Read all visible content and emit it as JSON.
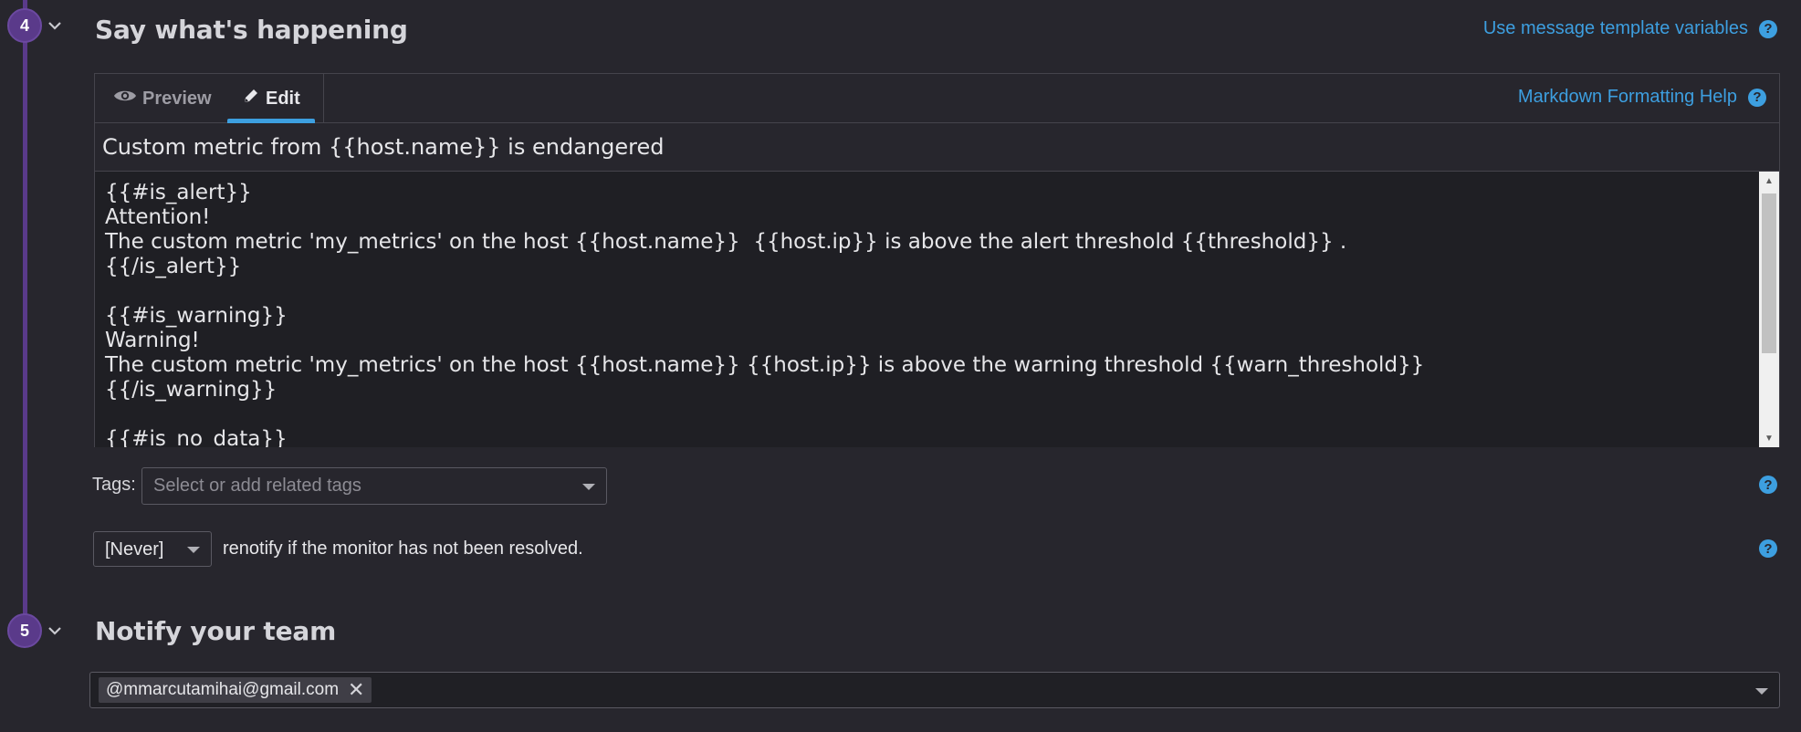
{
  "section4": {
    "step": "4",
    "title": "Say what's happening",
    "template_link": "Use message template variables"
  },
  "editor": {
    "tabs": [
      {
        "label": "Preview",
        "icon": "eye-icon"
      },
      {
        "label": "Edit",
        "icon": "pencil-icon",
        "active": true
      }
    ],
    "markdown_help": "Markdown Formatting Help",
    "subject": "Custom metric from {{host.name}} is endangered",
    "body": "{{#is_alert}}\nAttention!\nThe custom metric 'my_metrics' on the host {{host.name}}  {{host.ip}} is above the alert threshold {{threshold}} .\n{{/is_alert}}\n\n{{#is_warning}}\nWarning!\nThe custom metric 'my_metrics' on the host {{host.name}} {{host.ip}} is above the warning threshold {{warn_threshold}}\n{{/is_warning}}\n\n{{#is_no_data}}"
  },
  "tags": {
    "label": "Tags:",
    "placeholder": "Select or add related tags"
  },
  "renotify": {
    "value": "[Never]",
    "text": "renotify if the monitor has not been resolved."
  },
  "section5": {
    "step": "5",
    "title": "Notify your team",
    "recipients": [
      "@mmarcutamihai@gmail.com"
    ]
  },
  "colors": {
    "accent": "#3d9fe0",
    "step": "#5a3a8a",
    "background": "#27262d"
  }
}
